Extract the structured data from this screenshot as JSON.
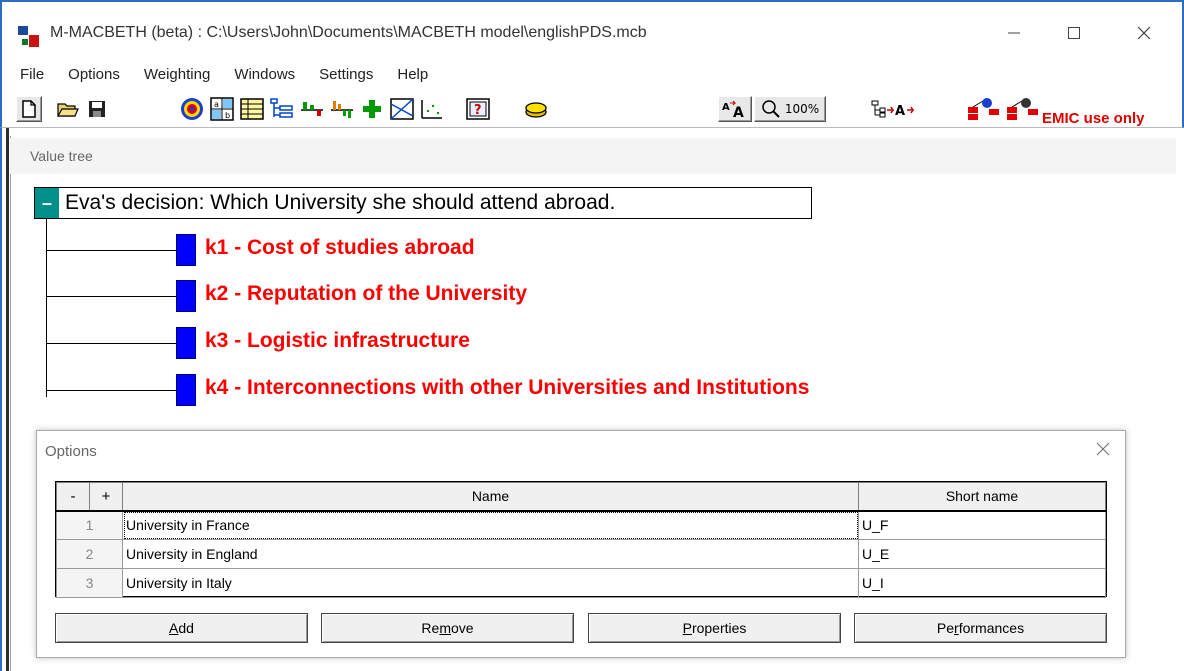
{
  "window": {
    "title": "M-MACBETH (beta) : C:\\Users\\John\\Documents\\MACBETH model\\englishPDS.mcb",
    "controls": [
      "—",
      "☐",
      "✕"
    ]
  },
  "menu": [
    "File",
    "Options",
    "Weighting",
    "Windows",
    "Settings",
    "Help"
  ],
  "toolbar": {
    "zoom_label": "100%",
    "font_label": "A",
    "tree_label": "A",
    "emic_text": "EMIC use only"
  },
  "value_tree": {
    "panel_label": "Value tree",
    "root": {
      "toggle": "–",
      "text": "Eva's decision: Which University she should attend abroad."
    },
    "criteria": [
      "k1 - Cost of studies abroad",
      "k2 - Reputation of the University",
      "k3 - Logistic infrastructure",
      "k4 - Interconnections with other Universities and Institutions"
    ]
  },
  "options_dialog": {
    "title": "Options",
    "close": "✕",
    "grid": {
      "minus": "-",
      "plus": "+",
      "col_name": "Name",
      "col_short": "Short name",
      "rows": [
        {
          "num": "1",
          "name": "University in France",
          "short": "U_F"
        },
        {
          "num": "2",
          "name": "University in England",
          "short": "U_E"
        },
        {
          "num": "3",
          "name": "University in Italy",
          "short": "U_I"
        }
      ]
    },
    "buttons": {
      "add": {
        "pre": "",
        "key": "A",
        "post": "dd"
      },
      "remove": {
        "pre": "Re",
        "key": "m",
        "post": "ove"
      },
      "properties": {
        "pre": "",
        "key": "P",
        "post": "roperties"
      },
      "performances": {
        "pre": "Pe",
        "key": "r",
        "post": "formances"
      }
    }
  },
  "colors": {
    "criterion_text": "#ff0000",
    "criterion_box": "#0000ff",
    "root_toggle": "#00908c",
    "emic_text": "#e00000",
    "window_border": "#2b6cc4"
  }
}
